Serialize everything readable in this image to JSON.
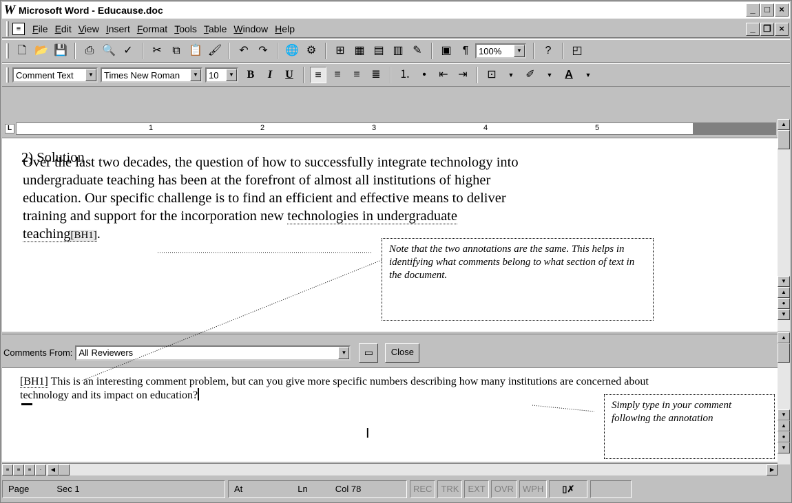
{
  "window": {
    "title": "Microsoft Word - Educause.doc",
    "app_logo": "W"
  },
  "menu": [
    "File",
    "Edit",
    "View",
    "Insert",
    "Format",
    "Tools",
    "Table",
    "Window",
    "Help"
  ],
  "standard_toolbar": {
    "zoom": "100%"
  },
  "formatting_toolbar": {
    "style": "Comment Text",
    "font": "Times New Roman",
    "size": "10",
    "bold": "B",
    "italic": "I",
    "underline": "U"
  },
  "ruler": {
    "marks": [
      "1",
      "2",
      "3",
      "4",
      "5"
    ]
  },
  "document": {
    "paragraph_lines": [
      "Over the last two decades, the question of how to successfully integrate technology into",
      "undergraduate teaching has been at the forefront of almost all institutions of higher",
      "education.  Our specific challenge is to find an efficient and effective means to deliver"
    ],
    "line4_plain": "training and support for the incorporation new ",
    "line4_marked": "technologies in undergraduate",
    "line5_marked": "teaching",
    "annotation_ref": "[BH1]",
    "line5_end": ".",
    "heading": "2) Solution"
  },
  "callouts": {
    "annotation_note": "Note that the two annotations are the same.  This helps in identifying what comments belong to what section of text in the document.",
    "comment_note": "Simply type in your comment following the annotation"
  },
  "comments_pane": {
    "label": "Comments From:",
    "reviewers": "All Reviewers",
    "close_label": "Close",
    "comment_ref": "[BH1]",
    "comment_text": " This is an interesting comment problem, but can you give more specific numbers describing how many institutions are concerned about technology and its impact on education?"
  },
  "status": {
    "page": "Page",
    "sec": "Sec 1",
    "at": "At",
    "ln": "Ln",
    "col": "Col 78",
    "modes": [
      "REC",
      "TRK",
      "EXT",
      "OVR",
      "WPH"
    ]
  }
}
